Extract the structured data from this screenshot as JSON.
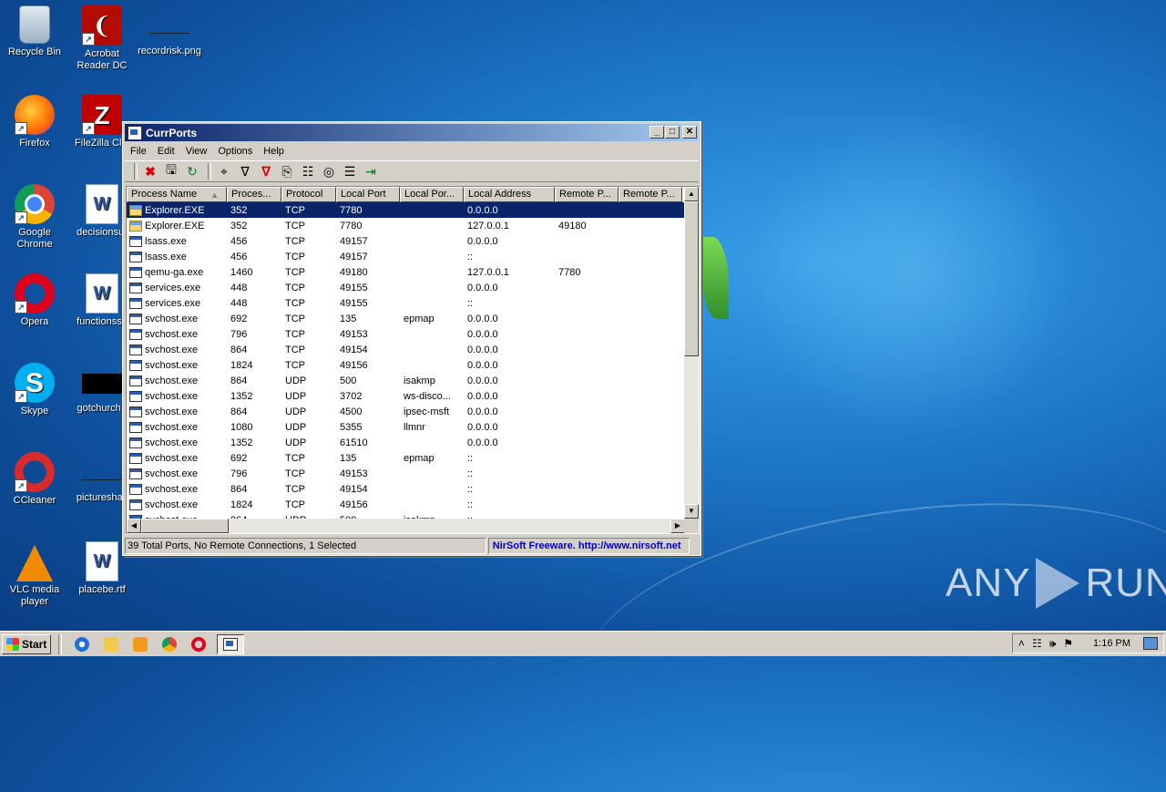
{
  "desktop": {
    "icons": [
      {
        "name": "recycle-bin",
        "label": "Recycle Bin"
      },
      {
        "name": "acrobat",
        "label": "Acrobat Reader DC"
      },
      {
        "name": "recordrisk",
        "label": "recordrisk.png"
      },
      {
        "name": "firefox",
        "label": "Firefox"
      },
      {
        "name": "filezilla",
        "label": "FileZilla Clie"
      },
      {
        "name": "chrome",
        "label": "Google Chrome"
      },
      {
        "name": "decisionsur",
        "label": "decisionsur"
      },
      {
        "name": "opera",
        "label": "Opera"
      },
      {
        "name": "functionssu",
        "label": "functionssu"
      },
      {
        "name": "skype",
        "label": "Skype"
      },
      {
        "name": "gotchurch",
        "label": "gotchurch.r"
      },
      {
        "name": "ccleaner",
        "label": "CCleaner"
      },
      {
        "name": "pictureshas",
        "label": "pictureshas"
      },
      {
        "name": "vlc",
        "label": "VLC media player"
      },
      {
        "name": "placebe",
        "label": "placebe.rtf"
      }
    ]
  },
  "window": {
    "title": "CurrPorts",
    "menu": [
      "File",
      "Edit",
      "View",
      "Options",
      "Help"
    ],
    "columns": [
      "Process Name",
      "Proces...",
      "Protocol",
      "Local Port",
      "Local Por...",
      "Local Address",
      "Remote P...",
      "Remote P..."
    ],
    "sort_indicator": "▲",
    "rows": [
      {
        "process": "Explorer.EXE",
        "pid": "352",
        "protocol": "TCP",
        "local_port": "7780",
        "local_port_name": "",
        "local_address": "0.0.0.0",
        "remote_port": "",
        "remote_port_name": "",
        "selected": true,
        "icon": "folder"
      },
      {
        "process": "Explorer.EXE",
        "pid": "352",
        "protocol": "TCP",
        "local_port": "7780",
        "local_port_name": "",
        "local_address": "127.0.0.1",
        "remote_port": "49180",
        "remote_port_name": "",
        "selected": false,
        "icon": "folder"
      },
      {
        "process": "lsass.exe",
        "pid": "456",
        "protocol": "TCP",
        "local_port": "49157",
        "local_port_name": "",
        "local_address": "0.0.0.0",
        "remote_port": "",
        "remote_port_name": "",
        "selected": false,
        "icon": "window"
      },
      {
        "process": "lsass.exe",
        "pid": "456",
        "protocol": "TCP",
        "local_port": "49157",
        "local_port_name": "",
        "local_address": "::",
        "remote_port": "",
        "remote_port_name": "",
        "selected": false,
        "icon": "window"
      },
      {
        "process": "qemu-ga.exe",
        "pid": "1460",
        "protocol": "TCP",
        "local_port": "49180",
        "local_port_name": "",
        "local_address": "127.0.0.1",
        "remote_port": "7780",
        "remote_port_name": "",
        "selected": false,
        "icon": "window"
      },
      {
        "process": "services.exe",
        "pid": "448",
        "protocol": "TCP",
        "local_port": "49155",
        "local_port_name": "",
        "local_address": "0.0.0.0",
        "remote_port": "",
        "remote_port_name": "",
        "selected": false,
        "icon": "window"
      },
      {
        "process": "services.exe",
        "pid": "448",
        "protocol": "TCP",
        "local_port": "49155",
        "local_port_name": "",
        "local_address": "::",
        "remote_port": "",
        "remote_port_name": "",
        "selected": false,
        "icon": "window"
      },
      {
        "process": "svchost.exe",
        "pid": "692",
        "protocol": "TCP",
        "local_port": "135",
        "local_port_name": "epmap",
        "local_address": "0.0.0.0",
        "remote_port": "",
        "remote_port_name": "",
        "selected": false,
        "icon": "window"
      },
      {
        "process": "svchost.exe",
        "pid": "796",
        "protocol": "TCP",
        "local_port": "49153",
        "local_port_name": "",
        "local_address": "0.0.0.0",
        "remote_port": "",
        "remote_port_name": "",
        "selected": false,
        "icon": "window"
      },
      {
        "process": "svchost.exe",
        "pid": "864",
        "protocol": "TCP",
        "local_port": "49154",
        "local_port_name": "",
        "local_address": "0.0.0.0",
        "remote_port": "",
        "remote_port_name": "",
        "selected": false,
        "icon": "window"
      },
      {
        "process": "svchost.exe",
        "pid": "1824",
        "protocol": "TCP",
        "local_port": "49156",
        "local_port_name": "",
        "local_address": "0.0.0.0",
        "remote_port": "",
        "remote_port_name": "",
        "selected": false,
        "icon": "window"
      },
      {
        "process": "svchost.exe",
        "pid": "864",
        "protocol": "UDP",
        "local_port": "500",
        "local_port_name": "isakmp",
        "local_address": "0.0.0.0",
        "remote_port": "",
        "remote_port_name": "",
        "selected": false,
        "icon": "window"
      },
      {
        "process": "svchost.exe",
        "pid": "1352",
        "protocol": "UDP",
        "local_port": "3702",
        "local_port_name": "ws-disco...",
        "local_address": "0.0.0.0",
        "remote_port": "",
        "remote_port_name": "",
        "selected": false,
        "icon": "window"
      },
      {
        "process": "svchost.exe",
        "pid": "864",
        "protocol": "UDP",
        "local_port": "4500",
        "local_port_name": "ipsec-msft",
        "local_address": "0.0.0.0",
        "remote_port": "",
        "remote_port_name": "",
        "selected": false,
        "icon": "window"
      },
      {
        "process": "svchost.exe",
        "pid": "1080",
        "protocol": "UDP",
        "local_port": "5355",
        "local_port_name": "llmnr",
        "local_address": "0.0.0.0",
        "remote_port": "",
        "remote_port_name": "",
        "selected": false,
        "icon": "window"
      },
      {
        "process": "svchost.exe",
        "pid": "1352",
        "protocol": "UDP",
        "local_port": "61510",
        "local_port_name": "",
        "local_address": "0.0.0.0",
        "remote_port": "",
        "remote_port_name": "",
        "selected": false,
        "icon": "window"
      },
      {
        "process": "svchost.exe",
        "pid": "692",
        "protocol": "TCP",
        "local_port": "135",
        "local_port_name": "epmap",
        "local_address": "::",
        "remote_port": "",
        "remote_port_name": "",
        "selected": false,
        "icon": "window"
      },
      {
        "process": "svchost.exe",
        "pid": "796",
        "protocol": "TCP",
        "local_port": "49153",
        "local_port_name": "",
        "local_address": "::",
        "remote_port": "",
        "remote_port_name": "",
        "selected": false,
        "icon": "window"
      },
      {
        "process": "svchost.exe",
        "pid": "864",
        "protocol": "TCP",
        "local_port": "49154",
        "local_port_name": "",
        "local_address": "::",
        "remote_port": "",
        "remote_port_name": "",
        "selected": false,
        "icon": "window"
      },
      {
        "process": "svchost.exe",
        "pid": "1824",
        "protocol": "TCP",
        "local_port": "49156",
        "local_port_name": "",
        "local_address": "::",
        "remote_port": "",
        "remote_port_name": "",
        "selected": false,
        "icon": "window"
      },
      {
        "process": "svchost.exe",
        "pid": "864",
        "protocol": "UDP",
        "local_port": "500",
        "local_port_name": "isakmp",
        "local_address": "::",
        "remote_port": "",
        "remote_port_name": "",
        "selected": false,
        "icon": "window"
      }
    ],
    "status_left": "39 Total Ports, No Remote Connections, 1 Selected",
    "status_right": "NirSoft Freeware.  http://www.nirsoft.net"
  },
  "watermark": {
    "left": "ANY",
    "right": "RUN"
  },
  "taskbar": {
    "start_label": "Start",
    "clock": "1:16 PM"
  },
  "colors": {
    "selection": "#0a246a",
    "title_start": "#0a246a",
    "title_end": "#a6caf0",
    "status_link": "#0000c0"
  }
}
